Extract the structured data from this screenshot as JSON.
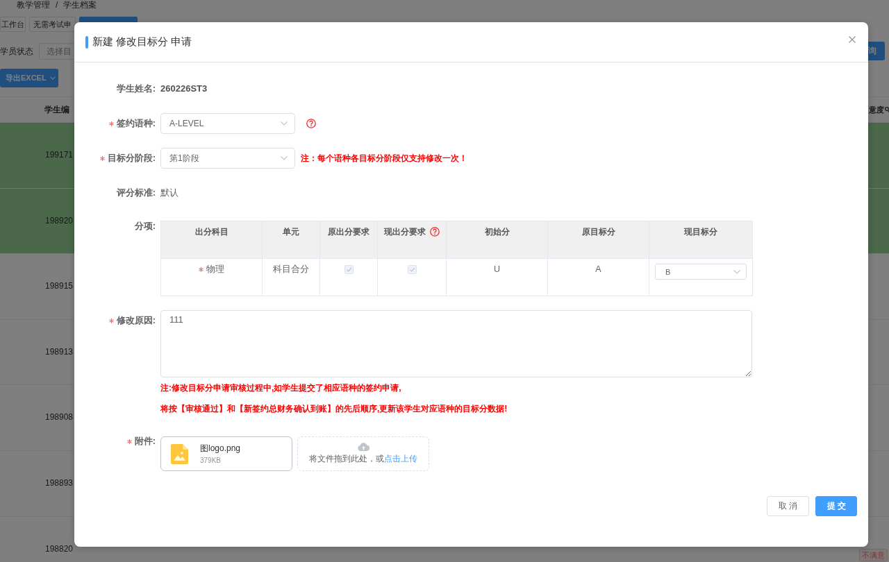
{
  "background_page": {
    "breadcrumb": {
      "items": [
        "教学管理",
        "学生档案"
      ],
      "separator": "/"
    },
    "tabs": [
      {
        "label": "工作台",
        "selected": false
      },
      {
        "label": "无需考试申",
        "selected": false
      },
      {
        "selected": true
      }
    ],
    "filter": {
      "label": "学员状态",
      "placeholder": "选择目"
    },
    "query_button": "询",
    "export_button": "导出EXCEL",
    "table": {
      "columns": [
        "学生编",
        "意度"
      ],
      "rows": [
        {
          "highlighted": true,
          "student_no": "199171"
        },
        {
          "highlighted": true,
          "student_no": "198920"
        },
        {
          "highlighted": false,
          "student_no": "198915"
        },
        {
          "highlighted": false,
          "student_no": "198913"
        },
        {
          "highlighted": false,
          "student_no": "198908"
        },
        {
          "highlighted": false,
          "student_no": "198893"
        },
        {
          "highlighted": false,
          "student_no": "198820",
          "satisfaction": "不满意"
        }
      ]
    }
  },
  "dialog": {
    "title": "新建 修改目标分 申请",
    "fields": [
      {
        "kind": "text",
        "label": "学生姓名:",
        "required": false,
        "value": "260226ST3",
        "bold": true
      },
      {
        "kind": "select",
        "label": "签约语种:",
        "required": true,
        "value": "A-LEVEL",
        "help": true
      },
      {
        "kind": "select",
        "label": "目标分阶段:",
        "required": true,
        "value": "第1阶段",
        "help": false,
        "note": "注：每个语种各目标分阶段仅支持修改一次！"
      },
      {
        "kind": "text",
        "label": "评分标准:",
        "required": false,
        "value": "默认",
        "bold": false
      },
      {
        "kind": "table",
        "label": "分项:",
        "required": false,
        "columns": [
          {
            "label": "出分科目",
            "help": false
          },
          {
            "label": "单元",
            "help": false
          },
          {
            "label": "原出分要求",
            "help": false
          },
          {
            "label": "现出分要求",
            "help": true
          },
          {
            "label": "初始分",
            "help": false
          },
          {
            "label": "原目标分",
            "help": false
          },
          {
            "label": "现目标分",
            "help": false
          }
        ],
        "rows": [
          {
            "cells": [
              {
                "kind": "text",
                "text": "物理",
                "required": true
              },
              {
                "kind": "text",
                "text": "科目合分",
                "required": false
              },
              {
                "kind": "checkbox",
                "checked": true,
                "disabled": true
              },
              {
                "kind": "checkbox",
                "checked": true,
                "disabled": true
              },
              {
                "kind": "text",
                "text": "U",
                "required": false
              },
              {
                "kind": "text",
                "text": "A",
                "required": false
              },
              {
                "kind": "select",
                "value": "B"
              }
            ]
          }
        ]
      },
      {
        "kind": "textarea",
        "label": "修改原因:",
        "required": true,
        "value": "111",
        "notes": [
          "注:修改目标分申请审核过程中,如学生提交了相应语种的签约申请,",
          "将按【审核通过】和【新签约总财务确认到账】的先后顺序,更新该学生对应语种的目标分数据!"
        ]
      },
      {
        "kind": "upload",
        "label": "附件:",
        "required": true,
        "files": [
          {
            "name": "图logo.png",
            "size": "379KB"
          }
        ],
        "drop_text": "将文件拖到此处，或",
        "drop_link": "点击上传"
      }
    ],
    "buttons": [
      {
        "label": "取消",
        "kind": "default"
      },
      {
        "label": "提交",
        "kind": "primary"
      }
    ]
  }
}
